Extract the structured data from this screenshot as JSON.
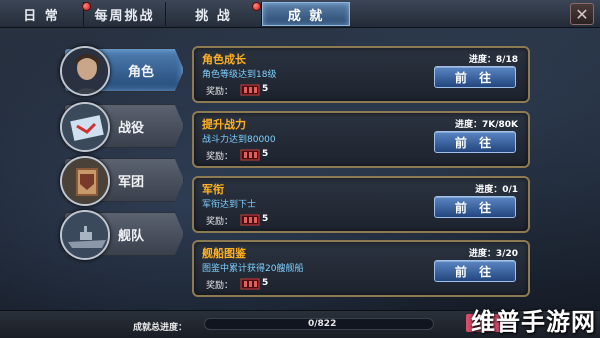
{
  "tabs": [
    {
      "label": "日 常",
      "badge": false
    },
    {
      "label": "每周挑战",
      "badge": true
    },
    {
      "label": "挑 战",
      "badge": true
    },
    {
      "label": "成 就",
      "badge": false,
      "active": true
    }
  ],
  "close_icon": "close-icon",
  "close_glyph": "✕",
  "nav": [
    {
      "label": "角色",
      "icon": "commander-portrait-icon",
      "active": true
    },
    {
      "label": "战役",
      "icon": "map-scroll-icon",
      "active": false
    },
    {
      "label": "军团",
      "icon": "legion-flag-icon",
      "active": false
    },
    {
      "label": "舰队",
      "icon": "warship-icon",
      "active": false
    }
  ],
  "cards": [
    {
      "title": "角色成长",
      "desc": "角色等级达到18级",
      "reward_label": "奖励：",
      "reward_count": "5",
      "progress": "进度：8/18",
      "button": "前 往"
    },
    {
      "title": "提升战力",
      "desc": "战斗力达到80000",
      "reward_label": "奖励：",
      "reward_count": "5",
      "progress": "进度：7K/80K",
      "button": "前 往"
    },
    {
      "title": "军衔",
      "desc": "军衔达到下士",
      "reward_label": "奖励：",
      "reward_count": "5",
      "progress": "进度：0/1",
      "button": "前 往"
    },
    {
      "title": "舰船图鉴",
      "desc": "图鉴中累计获得20艘舰船",
      "reward_label": "奖励：",
      "reward_count": "5",
      "progress": "进度：3/20",
      "button": "前 往"
    }
  ],
  "bottom": {
    "label": "成就总进度：",
    "value": "0/822",
    "progress_fraction": 0.0
  },
  "watermark": "维普手游网",
  "colors": {
    "accent": "#ffb020",
    "desc": "#7fd0ff",
    "button": "#23467e",
    "card_border": "#8e7a52"
  }
}
